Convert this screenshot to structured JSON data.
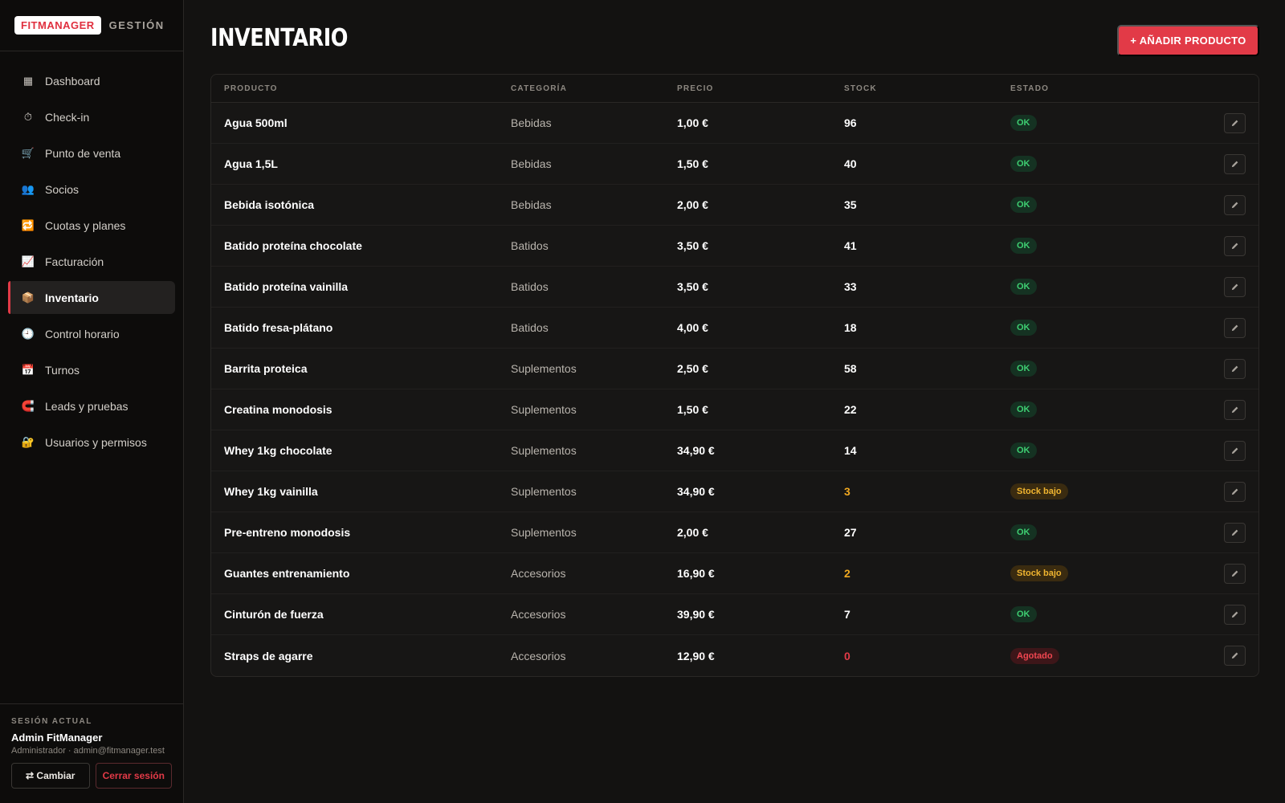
{
  "brand": {
    "logo": "FITMANAGER",
    "subtitle": "GESTIÓN"
  },
  "sidebar": {
    "items": [
      {
        "label": "Dashboard",
        "icon": "grid-icon",
        "glyph": "▦",
        "color": "#c9c5bf"
      },
      {
        "label": "Check-in",
        "icon": "stopwatch-icon",
        "glyph": "⏱",
        "color": "#d9d5cf"
      },
      {
        "label": "Punto de venta",
        "icon": "cart-icon",
        "glyph": "🛒",
        "color": "#c9c5bf"
      },
      {
        "label": "Socios",
        "icon": "users-icon",
        "glyph": "👥",
        "color": "#6a6fd0"
      },
      {
        "label": "Cuotas y planes",
        "icon": "repeat-icon",
        "glyph": "🔁",
        "color": "#3a8ee0"
      },
      {
        "label": "Facturación",
        "icon": "chart-up-icon",
        "glyph": "📈",
        "color": "#c9c5bf"
      },
      {
        "label": "Inventario",
        "icon": "package-icon",
        "glyph": "📦",
        "color": "#c8955a",
        "active": true
      },
      {
        "label": "Control horario",
        "icon": "clock-icon",
        "glyph": "🕘",
        "color": "#c9c5bf"
      },
      {
        "label": "Turnos",
        "icon": "calendar-icon",
        "glyph": "📅",
        "color": "#6a8fe0"
      },
      {
        "label": "Leads y pruebas",
        "icon": "magnet-icon",
        "glyph": "🧲",
        "color": "#e23a47"
      },
      {
        "label": "Usuarios y permisos",
        "icon": "lock-icon",
        "glyph": "🔐",
        "color": "#e0a030"
      }
    ]
  },
  "session": {
    "label": "SESIÓN ACTUAL",
    "name": "Admin FitManager",
    "role": "Administrador · admin@fitmanager.test",
    "switch_label": "⇄ Cambiar",
    "logout_label": "Cerrar sesión"
  },
  "page": {
    "title": "INVENTARIO",
    "add_button": "+ AÑADIR PRODUCTO"
  },
  "table": {
    "columns": [
      "PRODUCTO",
      "CATEGORÍA",
      "PRECIO",
      "STOCK",
      "ESTADO"
    ],
    "rows": [
      {
        "product": "Agua 500ml",
        "category": "Bebidas",
        "price": "1,00 €",
        "stock": "96",
        "status": "OK",
        "level": "ok"
      },
      {
        "product": "Agua 1,5L",
        "category": "Bebidas",
        "price": "1,50 €",
        "stock": "40",
        "status": "OK",
        "level": "ok"
      },
      {
        "product": "Bebida isotónica",
        "category": "Bebidas",
        "price": "2,00 €",
        "stock": "35",
        "status": "OK",
        "level": "ok"
      },
      {
        "product": "Batido proteína chocolate",
        "category": "Batidos",
        "price": "3,50 €",
        "stock": "41",
        "status": "OK",
        "level": "ok"
      },
      {
        "product": "Batido proteína vainilla",
        "category": "Batidos",
        "price": "3,50 €",
        "stock": "33",
        "status": "OK",
        "level": "ok"
      },
      {
        "product": "Batido fresa-plátano",
        "category": "Batidos",
        "price": "4,00 €",
        "stock": "18",
        "status": "OK",
        "level": "ok"
      },
      {
        "product": "Barrita proteica",
        "category": "Suplementos",
        "price": "2,50 €",
        "stock": "58",
        "status": "OK",
        "level": "ok"
      },
      {
        "product": "Creatina monodosis",
        "category": "Suplementos",
        "price": "1,50 €",
        "stock": "22",
        "status": "OK",
        "level": "ok"
      },
      {
        "product": "Whey 1kg chocolate",
        "category": "Suplementos",
        "price": "34,90 €",
        "stock": "14",
        "status": "OK",
        "level": "ok"
      },
      {
        "product": "Whey 1kg vainilla",
        "category": "Suplementos",
        "price": "34,90 €",
        "stock": "3",
        "status": "Stock bajo",
        "level": "low"
      },
      {
        "product": "Pre-entreno monodosis",
        "category": "Suplementos",
        "price": "2,00 €",
        "stock": "27",
        "status": "OK",
        "level": "ok"
      },
      {
        "product": "Guantes entrenamiento",
        "category": "Accesorios",
        "price": "16,90 €",
        "stock": "2",
        "status": "Stock bajo",
        "level": "low"
      },
      {
        "product": "Cinturón de fuerza",
        "category": "Accesorios",
        "price": "39,90 €",
        "stock": "7",
        "status": "OK",
        "level": "ok"
      },
      {
        "product": "Straps de agarre",
        "category": "Accesorios",
        "price": "12,90 €",
        "stock": "0",
        "status": "Agotado",
        "level": "out"
      }
    ],
    "edit_icon": "pencil-icon"
  },
  "colors": {
    "accent": "#e23a47",
    "ok": "#3ecf72",
    "low": "#f0a820",
    "out": "#e23a47"
  }
}
